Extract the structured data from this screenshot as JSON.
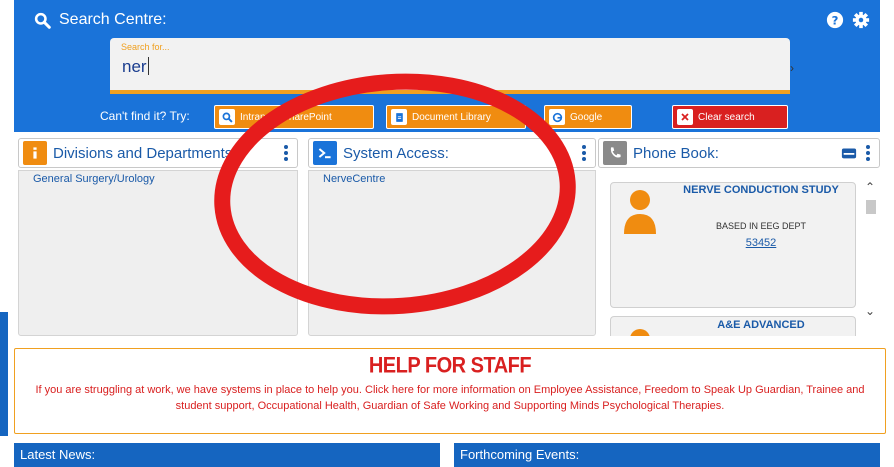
{
  "search": {
    "title": "Search Centre:",
    "placeholder": "Search for...",
    "value": "ner",
    "try_label": "Can't find it? Try:",
    "buttons": {
      "intranet": "Intranet / SharePoint",
      "document_library": "Document Library",
      "google": "Google",
      "clear": "Clear search"
    }
  },
  "panels": {
    "divisions": {
      "title": "Divisions and Departments:",
      "items": [
        "General Surgery/Urology"
      ]
    },
    "system": {
      "title": "System Access:",
      "items": [
        "NerveCentre"
      ]
    },
    "phone": {
      "title": "Phone Book:",
      "cards": [
        {
          "title": "NERVE CONDUCTION STUDY",
          "subtitle": "BASED IN EEG DEPT",
          "number": "53452"
        },
        {
          "title": "A&E ADVANCED"
        }
      ]
    }
  },
  "help": {
    "title": "HELP FOR STAFF",
    "text": "If you are struggling at work, we have systems in place to help you. Click here for more information on Employee Assistance, Freedom to Speak Up Guardian, Trainee and student support, Occupational Health, Guardian of Safe Working and Supporting Minds Psychological Therapies."
  },
  "news": {
    "latest": "Latest News:",
    "events": "Forthcoming Events:"
  },
  "colors": {
    "primary": "#1a73d9",
    "accent": "#f0a020",
    "danger": "#d92020",
    "link": "#1a5aa8",
    "annotation": "#e61c1c"
  },
  "icons": [
    "search-icon",
    "help-icon",
    "gear-icon",
    "info-icon",
    "terminal-icon",
    "phone-icon",
    "card-icon",
    "kebab-icon",
    "document-icon",
    "google-icon",
    "close-icon",
    "person-icon"
  ]
}
